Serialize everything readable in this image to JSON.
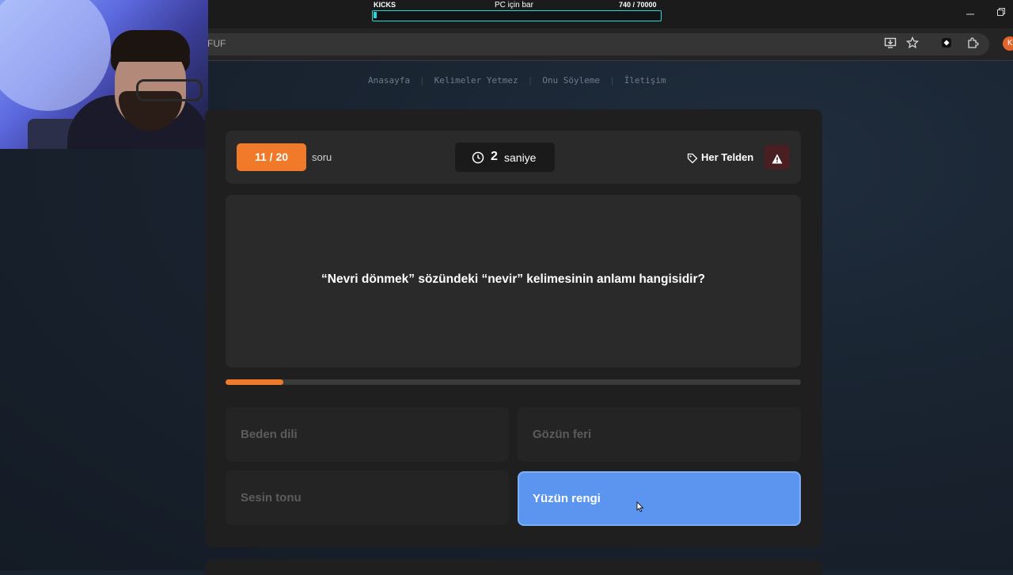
{
  "overlay": {
    "kicks_label": "KICKS",
    "bar_title": "PC için bar",
    "kicks_count": "740  / 70000",
    "progress_fraction": 0.0106
  },
  "browser": {
    "url_fragment": "FUF",
    "profile_initial": "K",
    "icons": [
      "install-icon",
      "star-icon",
      "extension-diamond-icon",
      "puzzle-icon",
      "minimize-icon",
      "restore-icon"
    ]
  },
  "nav": {
    "items": [
      "Anasayfa",
      "Kelimeler Yetmez",
      "Onu Söyleme",
      "İletişim"
    ]
  },
  "quiz": {
    "counter": "11 / 20",
    "counter_label": "soru",
    "timer_value": "2",
    "timer_unit": "saniye",
    "category": "Her Telden",
    "question": "“Nevri dönmek” sözündeki “nevir” kelimesinin anlamı hangisidir?",
    "time_progress": 0.1,
    "answers": [
      "Beden dili",
      "Gözün feri",
      "Sesin tonu",
      "Yüzün rengi"
    ],
    "selected_index": 3
  },
  "colors": {
    "accent_orange": "#f0792a",
    "selected_blue": "#5b95f0",
    "report_red": "#4a1f24",
    "kicks_cyan": "#2dd6d6"
  }
}
